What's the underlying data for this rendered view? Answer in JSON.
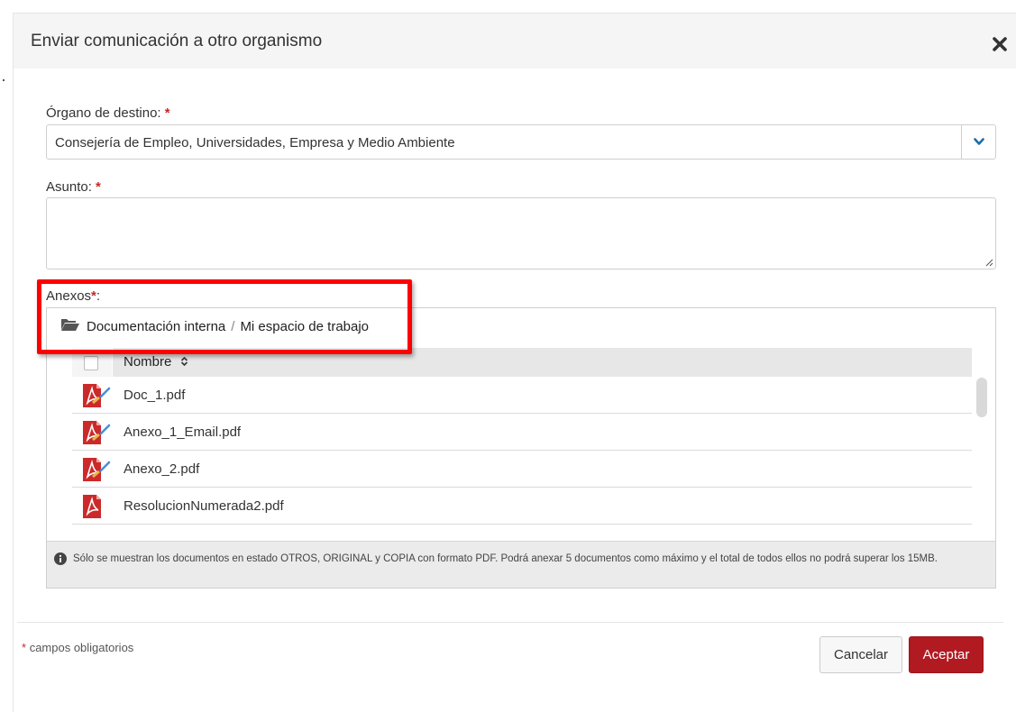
{
  "modal": {
    "title": "Enviar comunicación a otro organismo"
  },
  "form": {
    "organo": {
      "label": "Órgano de destino:",
      "required_mark": "*",
      "selected_value": "Consejería de Empleo, Universidades, Empresa y Medio Ambiente"
    },
    "asunto": {
      "label": "Asunto:",
      "required_mark": "*",
      "value": ""
    },
    "anexos": {
      "label": "Anexos",
      "required_mark": "*",
      "label_suffix": ":",
      "breadcrumb": [
        "Documentación interna",
        "Mi espacio de trabajo"
      ],
      "breadcrumb_separator": "/",
      "table": {
        "column_header": "Nombre",
        "rows": [
          {
            "name": "Doc_1.pdf",
            "icon": "pdf-signed-icon"
          },
          {
            "name": "Anexo_1_Email.pdf",
            "icon": "pdf-signed-icon"
          },
          {
            "name": "Anexo_2.pdf",
            "icon": "pdf-signed-icon"
          },
          {
            "name": "ResolucionNumerada2.pdf",
            "icon": "pdf-icon"
          }
        ]
      },
      "info": "Sólo se muestran los documentos en estado OTROS, ORIGINAL y COPIA con formato PDF. Podrá anexar 5 documentos como máximo y el total de todos ellos no podrá superar los 15MB."
    }
  },
  "footer": {
    "required_mark": "*",
    "note": "campos obligatorios",
    "cancel_label": "Cancelar",
    "accept_label": "Aceptar"
  },
  "colors": {
    "accent_red": "#b11a21",
    "required_red": "#c62828",
    "highlight_red": "#ff0000",
    "select_arrow_blue": "#1a6fa8"
  }
}
